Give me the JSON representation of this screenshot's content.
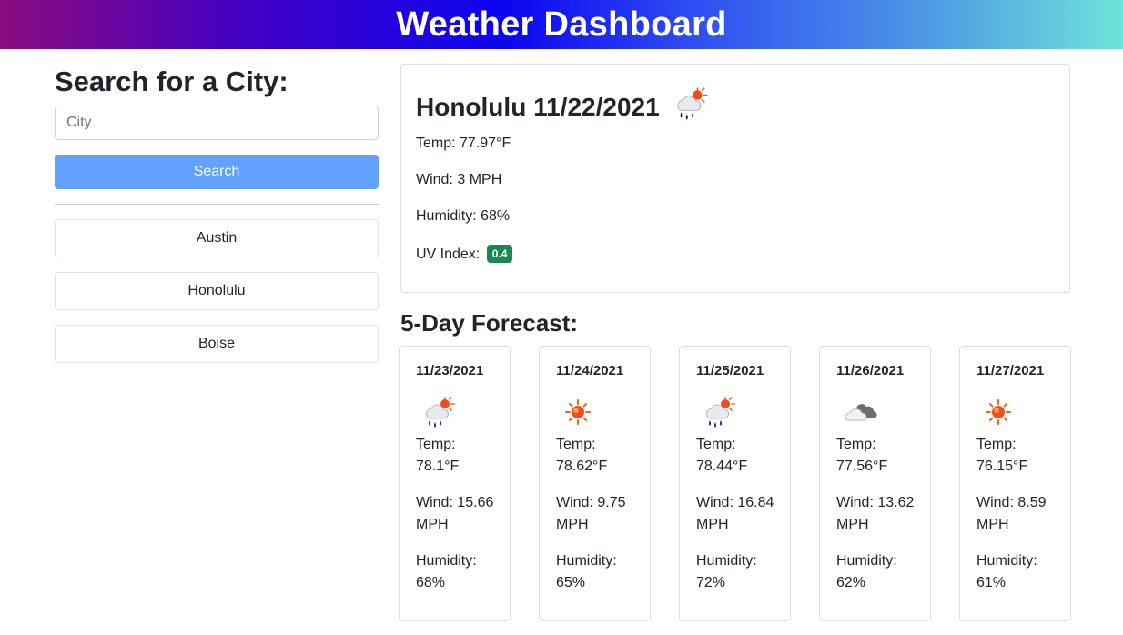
{
  "header": {
    "title": "Weather Dashboard"
  },
  "sidebar": {
    "title": "Search for a City:",
    "input_placeholder": "City",
    "search_label": "Search",
    "history": [
      "Austin",
      "Honolulu",
      "Boise"
    ]
  },
  "current": {
    "title": "Honolulu 11/22/2021",
    "icon": "rain-sun-icon",
    "temp": "Temp: 77.97°F",
    "wind": "Wind: 3 MPH",
    "humidity": "Humidity: 68%",
    "uv_label": "UV Index:",
    "uv_value": "0.4",
    "uv_color": "#198754"
  },
  "forecast": {
    "title": "5-Day Forecast:",
    "days": [
      {
        "date": "11/23/2021",
        "icon": "rain-sun-icon",
        "temp_label": "Temp:",
        "temp": "78.1°F",
        "wind_label": "Wind: 15.66",
        "wind_unit": "MPH",
        "hum_label": "Humidity:",
        "hum": "68%"
      },
      {
        "date": "11/24/2021",
        "icon": "sun-icon",
        "temp_label": "Temp:",
        "temp": "78.62°F",
        "wind_label": "Wind: 9.75",
        "wind_unit": "MPH",
        "hum_label": "Humidity:",
        "hum": "65%"
      },
      {
        "date": "11/25/2021",
        "icon": "rain-sun-icon",
        "temp_label": "Temp:",
        "temp": "78.44°F",
        "wind_label": "Wind: 16.84",
        "wind_unit": "MPH",
        "hum_label": "Humidity:",
        "hum": "72%"
      },
      {
        "date": "11/26/2021",
        "icon": "cloud-icon",
        "temp_label": "Temp:",
        "temp": "77.56°F",
        "wind_label": "Wind: 13.62",
        "wind_unit": "MPH",
        "hum_label": "Humidity:",
        "hum": "62%"
      },
      {
        "date": "11/27/2021",
        "icon": "sun-icon",
        "temp_label": "Temp:",
        "temp": "76.15°F",
        "wind_label": "Wind: 8.59",
        "wind_unit": "MPH",
        "hum_label": "Humidity:",
        "hum": "61%"
      }
    ]
  },
  "colors": {
    "search_button": "#62a1fe",
    "uv_badge": "#198754"
  }
}
